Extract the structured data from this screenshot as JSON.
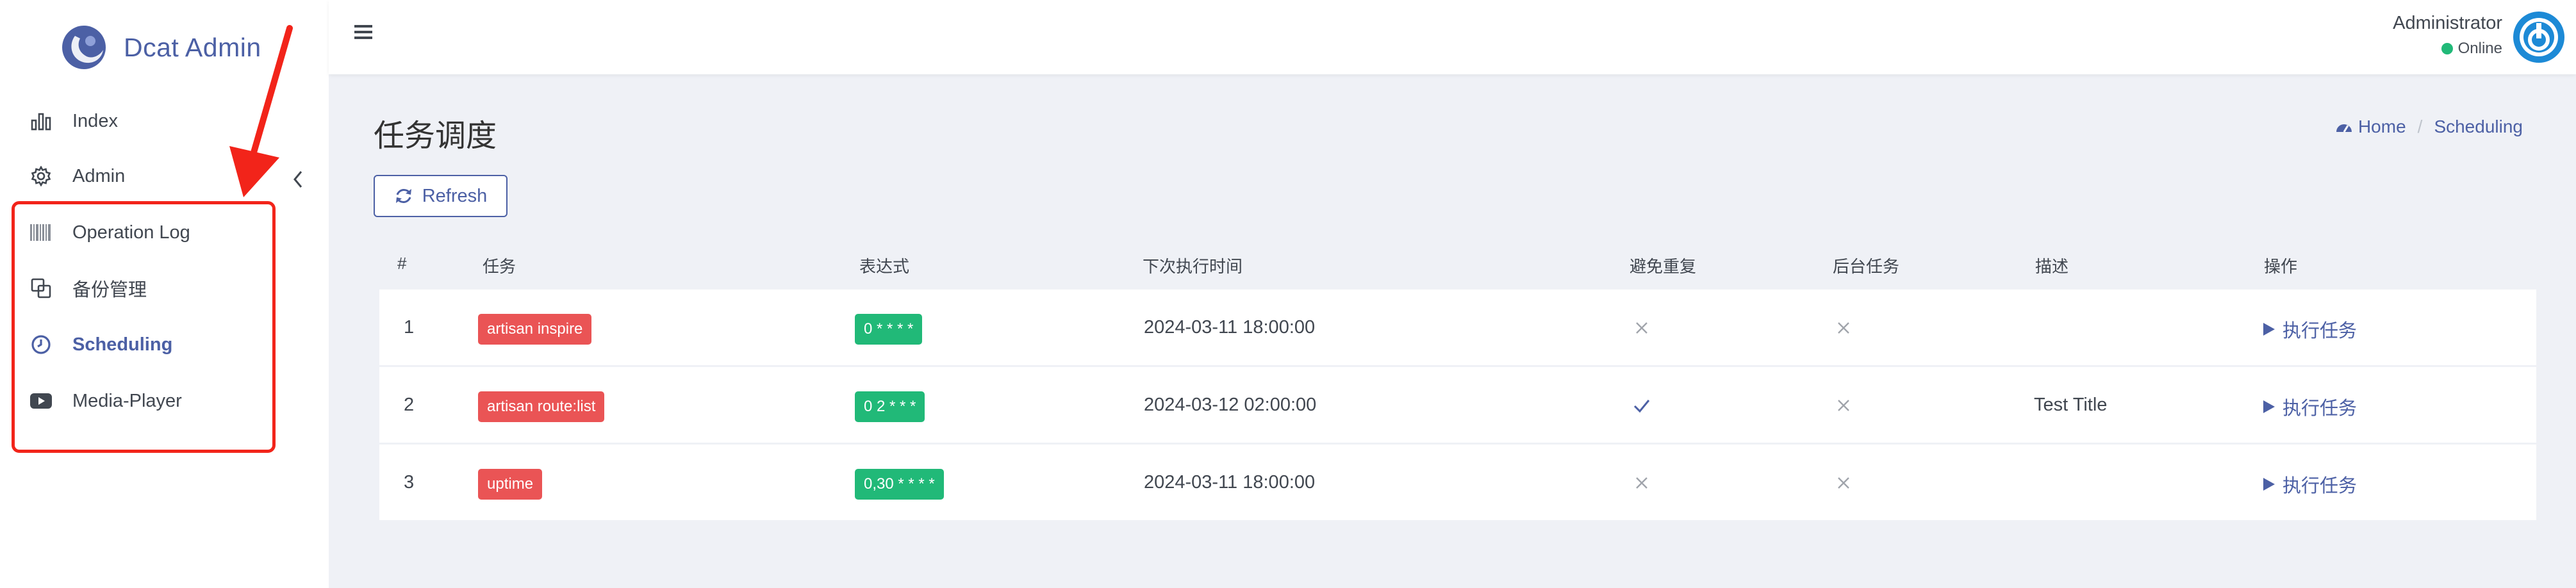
{
  "brand": {
    "name": "Dcat Admin"
  },
  "sidebar": {
    "items": [
      {
        "label": "Index",
        "icon": "bar-chart-icon"
      },
      {
        "label": "Admin",
        "icon": "gear-icon"
      },
      {
        "label": "Operation Log",
        "icon": "barcode-icon"
      },
      {
        "label": "备份管理",
        "icon": "copy-icon"
      },
      {
        "label": "Scheduling",
        "icon": "clock-icon",
        "active": true
      },
      {
        "label": "Media-Player",
        "icon": "youtube-icon"
      }
    ]
  },
  "navbar": {
    "user_name": "Administrator",
    "user_status": "Online"
  },
  "page": {
    "title": "任务调度",
    "breadcrumb": {
      "home": "Home",
      "current": "Scheduling"
    },
    "refresh_label": "Refresh"
  },
  "table": {
    "headers": [
      "#",
      "任务",
      "表达式",
      "下次执行时间",
      "避免重复",
      "后台任务",
      "描述",
      "操作"
    ],
    "rows": [
      {
        "id": "1",
        "task": "artisan inspire",
        "expression": "0 * * * *",
        "next_run": "2024-03-11 18:00:00",
        "without_overlapping": false,
        "background": false,
        "description": "",
        "action": "执行任务"
      },
      {
        "id": "2",
        "task": "artisan route:list",
        "expression": "0 2 * * *",
        "next_run": "2024-03-12 02:00:00",
        "without_overlapping": true,
        "background": false,
        "description": "Test Title",
        "action": "执行任务"
      },
      {
        "id": "3",
        "task": "uptime",
        "expression": "0,30 * * * *",
        "next_run": "2024-03-11 18:00:00",
        "without_overlapping": false,
        "background": false,
        "description": "",
        "action": "执行任务"
      }
    ]
  },
  "colors": {
    "primary": "#4c60a5",
    "danger": "#ea5455",
    "success": "#21b978",
    "annotation": "#f2241a",
    "background": "#eff1f6"
  }
}
